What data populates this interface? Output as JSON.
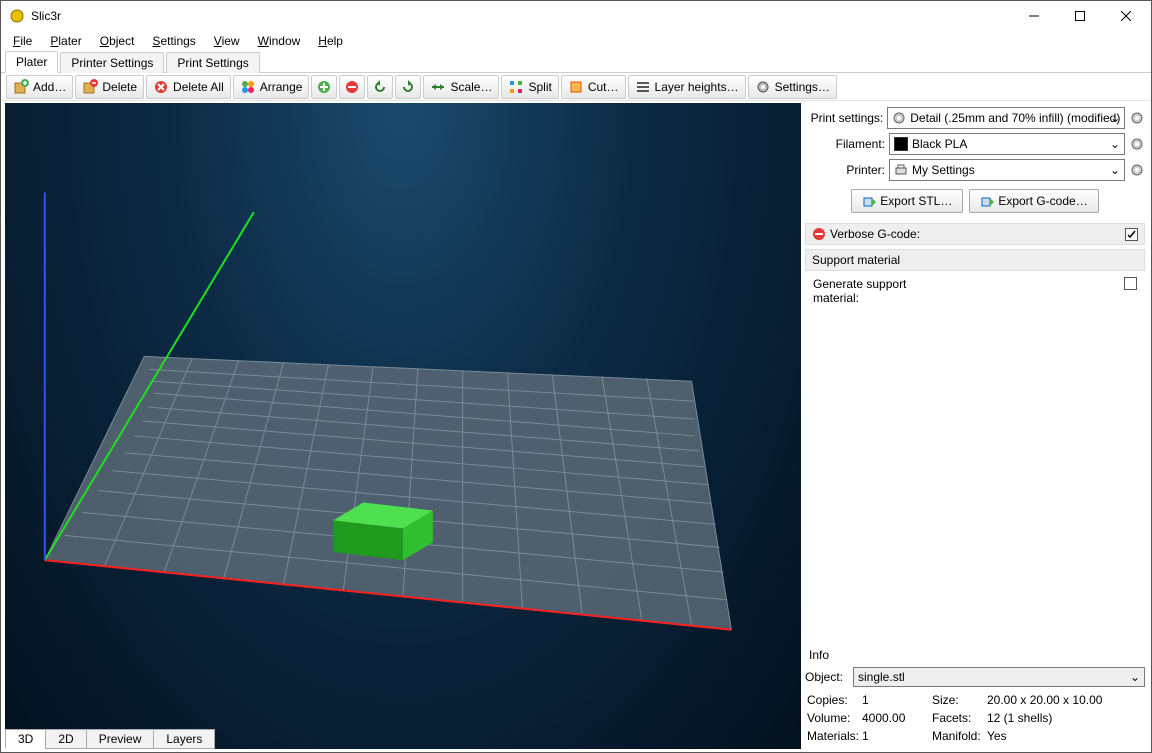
{
  "window": {
    "title": "Slic3r"
  },
  "menu": [
    "File",
    "Plater",
    "Object",
    "Settings",
    "View",
    "Window",
    "Help"
  ],
  "top_tabs": [
    "Plater",
    "Printer Settings",
    "Print Settings"
  ],
  "toolbar": {
    "add": "Add…",
    "delete": "Delete",
    "delete_all": "Delete All",
    "arrange": "Arrange",
    "scale": "Scale…",
    "split": "Split",
    "cut": "Cut…",
    "layer_heights": "Layer heights…",
    "settings": "Settings…"
  },
  "side": {
    "print_settings_label": "Print settings:",
    "print_settings_value": "Detail (.25mm and 70% infill) (modified)",
    "filament_label": "Filament:",
    "filament_value": "Black PLA",
    "printer_label": "Printer:",
    "printer_value": "My Settings",
    "export_stl": "Export STL…",
    "export_gcode": "Export G-code…",
    "verbose_label": "Verbose G-code:",
    "support_head": "Support material",
    "generate_support_label": "Generate support material:"
  },
  "info": {
    "head": "Info",
    "object_label": "Object:",
    "object_value": "single.stl",
    "copies_label": "Copies:",
    "copies_value": "1",
    "size_label": "Size:",
    "size_value": "20.00 x 20.00 x 10.00",
    "volume_label": "Volume:",
    "volume_value": "4000.00",
    "facets_label": "Facets:",
    "facets_value": "12 (1 shells)",
    "materials_label": "Materials:",
    "materials_value": "1",
    "manifold_label": "Manifold:",
    "manifold_value": "Yes"
  },
  "bottom_tabs": [
    "3D",
    "2D",
    "Preview",
    "Layers"
  ]
}
